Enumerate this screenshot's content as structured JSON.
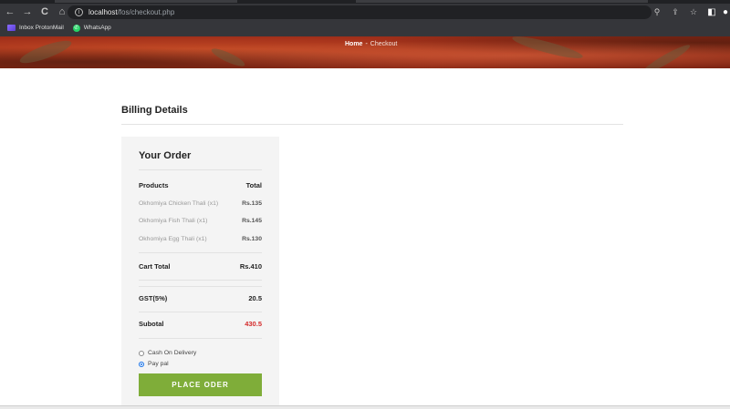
{
  "browser": {
    "nav_icons": {
      "back": "←",
      "forward": "→",
      "reload": "C",
      "home": "⌂"
    },
    "info_icon": "i",
    "url_host": "localhost",
    "url_path": "/fos/checkout.php",
    "right_icons": {
      "zoom": "⚲",
      "share": "⇪",
      "star": "☆",
      "sidepanel": "◧",
      "profile": "●"
    },
    "bookmarks": [
      {
        "label": "Inbox ProtonMail",
        "icon": "protonmail-icon"
      },
      {
        "label": "WhatsApp",
        "icon": "whatsapp-icon"
      }
    ]
  },
  "hero": {
    "breadcrumb_home": "Home",
    "breadcrumb_sep": "-",
    "breadcrumb_current": "Checkout"
  },
  "billing": {
    "title": "Billing Details"
  },
  "order": {
    "title": "Your Order",
    "col_products": "Products",
    "col_total": "Total",
    "items": [
      {
        "name": "Okhomiya Chicken Thali (x1)",
        "price": "Rs.135"
      },
      {
        "name": "Okhomiya Fish Thali (x1)",
        "price": "Rs.145"
      },
      {
        "name": "Okhomiya Egg Thali (x1)",
        "price": "Rs.130"
      }
    ],
    "cart_total_label": "Cart Total",
    "cart_total_value": "Rs.410",
    "gst_label": "GST(5%)",
    "gst_value": "20.5",
    "subtotal_label": "Subotal",
    "subtotal_value": "430.5",
    "subtotal_color": "#d42b2b",
    "payment_options": [
      {
        "label": "Cash On Delivery",
        "selected": false
      },
      {
        "label": "Pay pal",
        "selected": true
      }
    ],
    "place_button": "PLACE ODER",
    "button_color": "#7fad39"
  }
}
